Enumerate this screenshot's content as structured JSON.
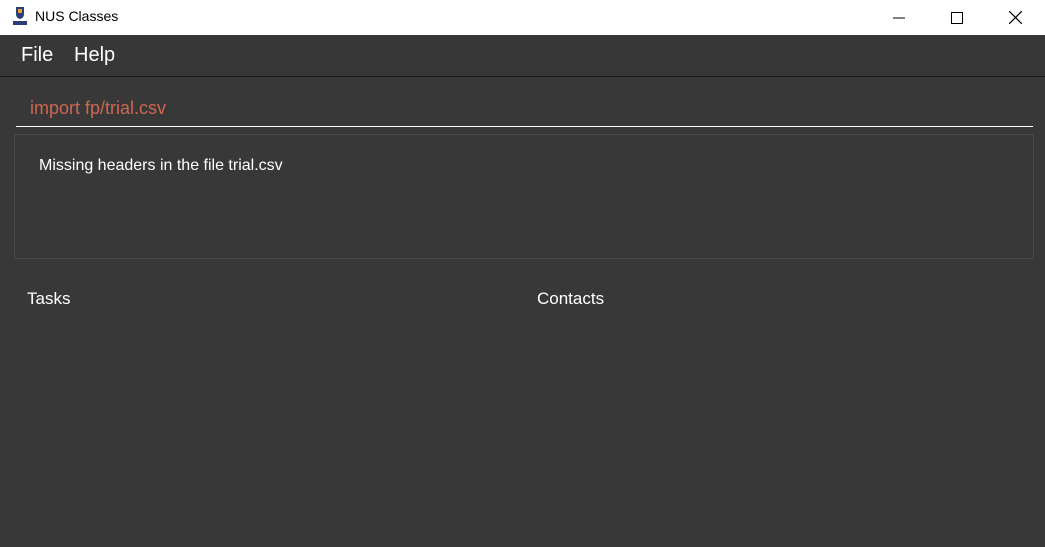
{
  "window": {
    "title": "NUS Classes",
    "icon": "nus-logo-icon",
    "controls": [
      "minimize-icon",
      "maximize-icon",
      "close-icon"
    ]
  },
  "menu": {
    "file": "File",
    "help": "Help"
  },
  "command": {
    "value": "import fp/trial.csv",
    "text_color": "#d06651"
  },
  "result": {
    "message": "Missing headers in the file trial.csv"
  },
  "panels": {
    "tasks": "Tasks",
    "contacts": "Contacts"
  },
  "colors": {
    "background": "#383838",
    "titlebar": "#ffffff",
    "text": "#ffffff",
    "command_text": "#d06651"
  }
}
